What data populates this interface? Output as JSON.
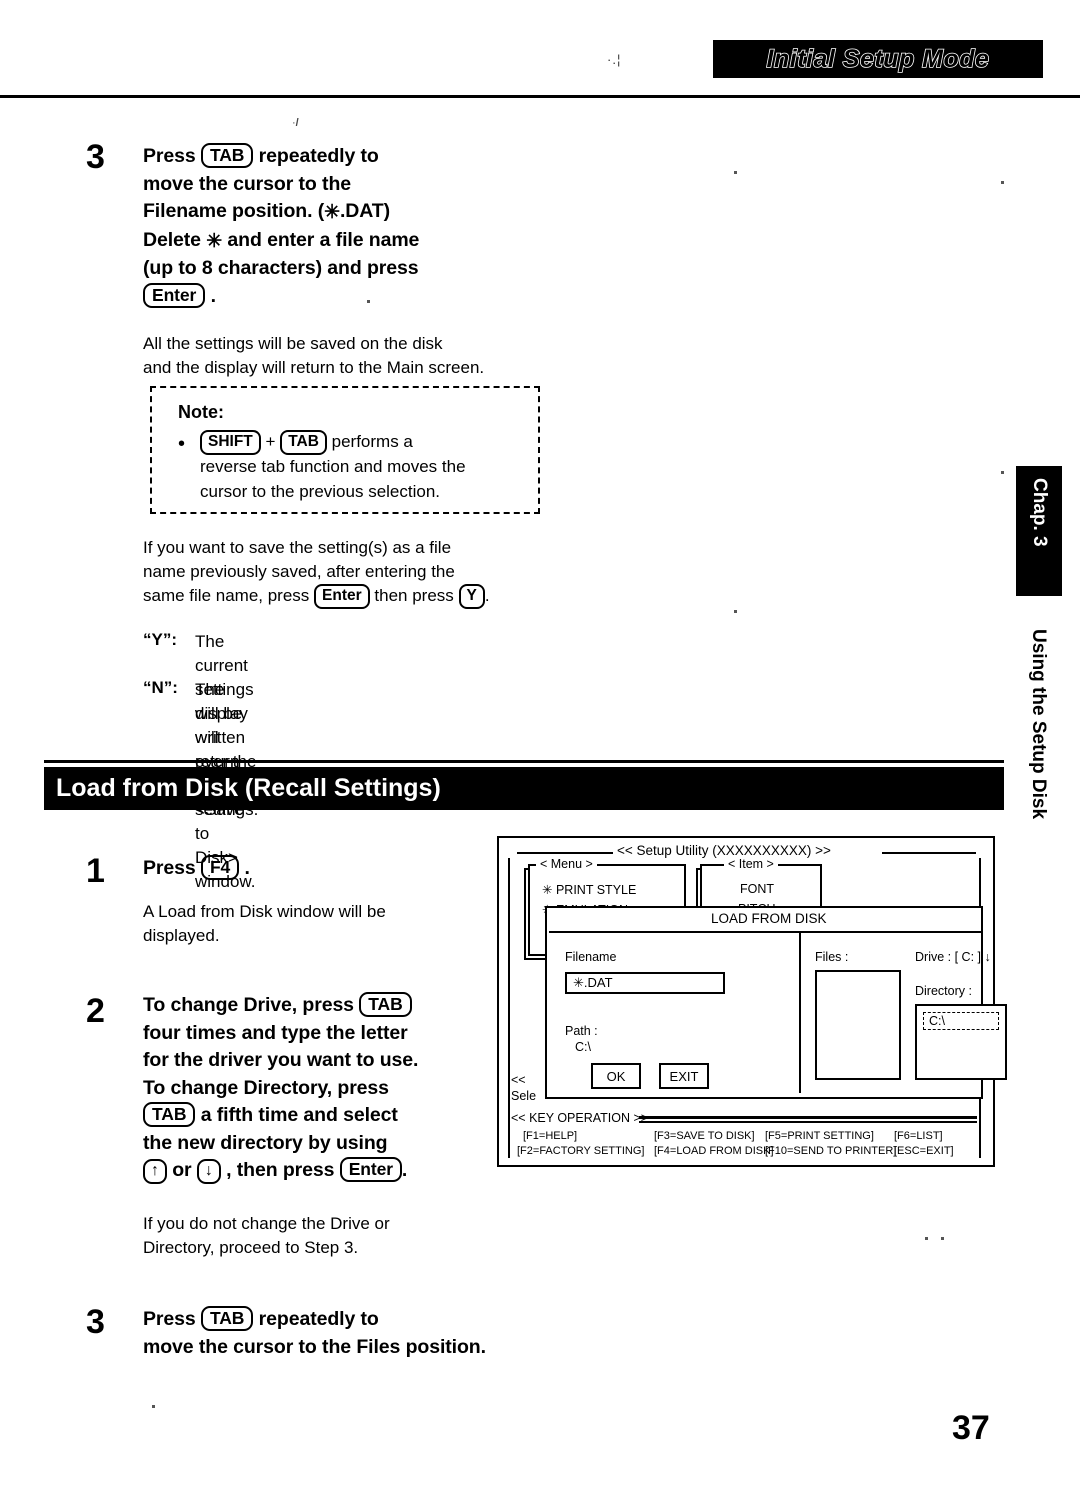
{
  "header": {
    "title": "Initial Setup Mode",
    "speck": "·.¦"
  },
  "chapter_tab": {
    "tab_label": "Chap. 3",
    "sub_label": "Using the Setup Disk"
  },
  "page_number": "37",
  "step3_top": {
    "number": "3",
    "line1_a": "Press",
    "key_tab": "TAB",
    "line1_b": "repeatedly to",
    "line2": "move the cursor to the",
    "line3_a": "Filename position. (",
    "line3_star": "✳",
    "line3_b": ".DAT)",
    "line4_a": "Delete",
    "line4_star": "✳",
    "line4_b": "and enter a file name",
    "line5": "(up to 8 characters) and press",
    "key_enter": "Enter",
    "line6_tail": "."
  },
  "save_desc": {
    "line1": "All the settings will be saved on the disk",
    "line2": "and the display will return to the Main screen."
  },
  "note": {
    "title": "Note:",
    "bullet": "•",
    "key_shift": "SHIFT",
    "plus": "+",
    "key_tab": "TAB",
    "line1_tail": "performs a",
    "line2": "reverse tab function and moves the",
    "line3": "cursor to the previous selection."
  },
  "overwrite_desc": {
    "line1": "If you want to save the setting(s) as a file",
    "line2": "name previously saved, after entering the",
    "line3_a": "same file name, press",
    "key_enter": "Enter",
    "line3_b": "then press",
    "key_y": "Y",
    "line3_c": "."
  },
  "yn_list": [
    {
      "label": "“Y”:",
      "line1": "The current settings will be written",
      "line2": "over the old settings."
    },
    {
      "label": "“N”:",
      "line1": "The display will return to a",
      "line2": "<Save to Disk> window."
    }
  ],
  "section": {
    "title": "Load from Disk (Recall Settings)"
  },
  "step1": {
    "number": "1",
    "line1_a": "Press",
    "key_f4": "F4",
    "line1_b": ".",
    "desc1": "A Load from Disk window will be",
    "desc2": "displayed."
  },
  "step2": {
    "number": "2",
    "line1_a": "To change Drive, press",
    "key_tab": "TAB",
    "line2": "four times and type the letter",
    "line3": "for the driver you want to use.",
    "line4": "To change Directory, press",
    "key_tab2": "TAB",
    "line5_b": "a fifth time and select",
    "line6": "the new directory by using",
    "key_up": "↑",
    "or": "or",
    "key_down": "↓",
    "line7_b": ", then press",
    "key_enter": "Enter",
    "line7_c": "."
  },
  "step2_note": {
    "line1": "If you do not change the Drive or",
    "line2": "Directory, proceed to Step 3."
  },
  "step3_bottom": {
    "number": "3",
    "line1_a": "Press",
    "key_tab": "TAB",
    "line1_b": "repeatedly to",
    "line2": "move the cursor to the Files position."
  },
  "figure": {
    "title": "<<  Setup Utility (XXXXXXXXXX)  >>",
    "menu_header": "< Menu >",
    "menu_items": [
      "PRINT STYLE",
      "EMULATION"
    ],
    "menu_star": "✳",
    "item_header": "< Item >",
    "item_items": [
      "FONT",
      "PITCH"
    ],
    "dialog_title": "LOAD FROM DISK",
    "filename_label": "Filename",
    "filename_value": "✳.DAT",
    "path_label": "Path   :",
    "path_value": "C:\\",
    "ok_label": "OK",
    "exit_label": "EXIT",
    "files_label": "Files   :",
    "drive_label": "Drive   :",
    "drive_value": "[ C:   ]",
    "drive_arrow": "↓",
    "directory_label": "Directory   :",
    "directory_value": "C:\\",
    "select_left1": "<<",
    "select_left2": "Sele",
    "key_operation_title": "<<  KEY OPERATION  >>",
    "key_ops": [
      "[F1=HELP]",
      "[F3=SAVE TO DISK]",
      "[F5=PRINT SETTING]",
      "[F6=LIST]",
      "[F2=FACTORY SETTING]",
      "[F4=LOAD FROM DISK]",
      "[F10=SEND TO PRINTER]",
      "[ESC=EXIT]"
    ]
  }
}
